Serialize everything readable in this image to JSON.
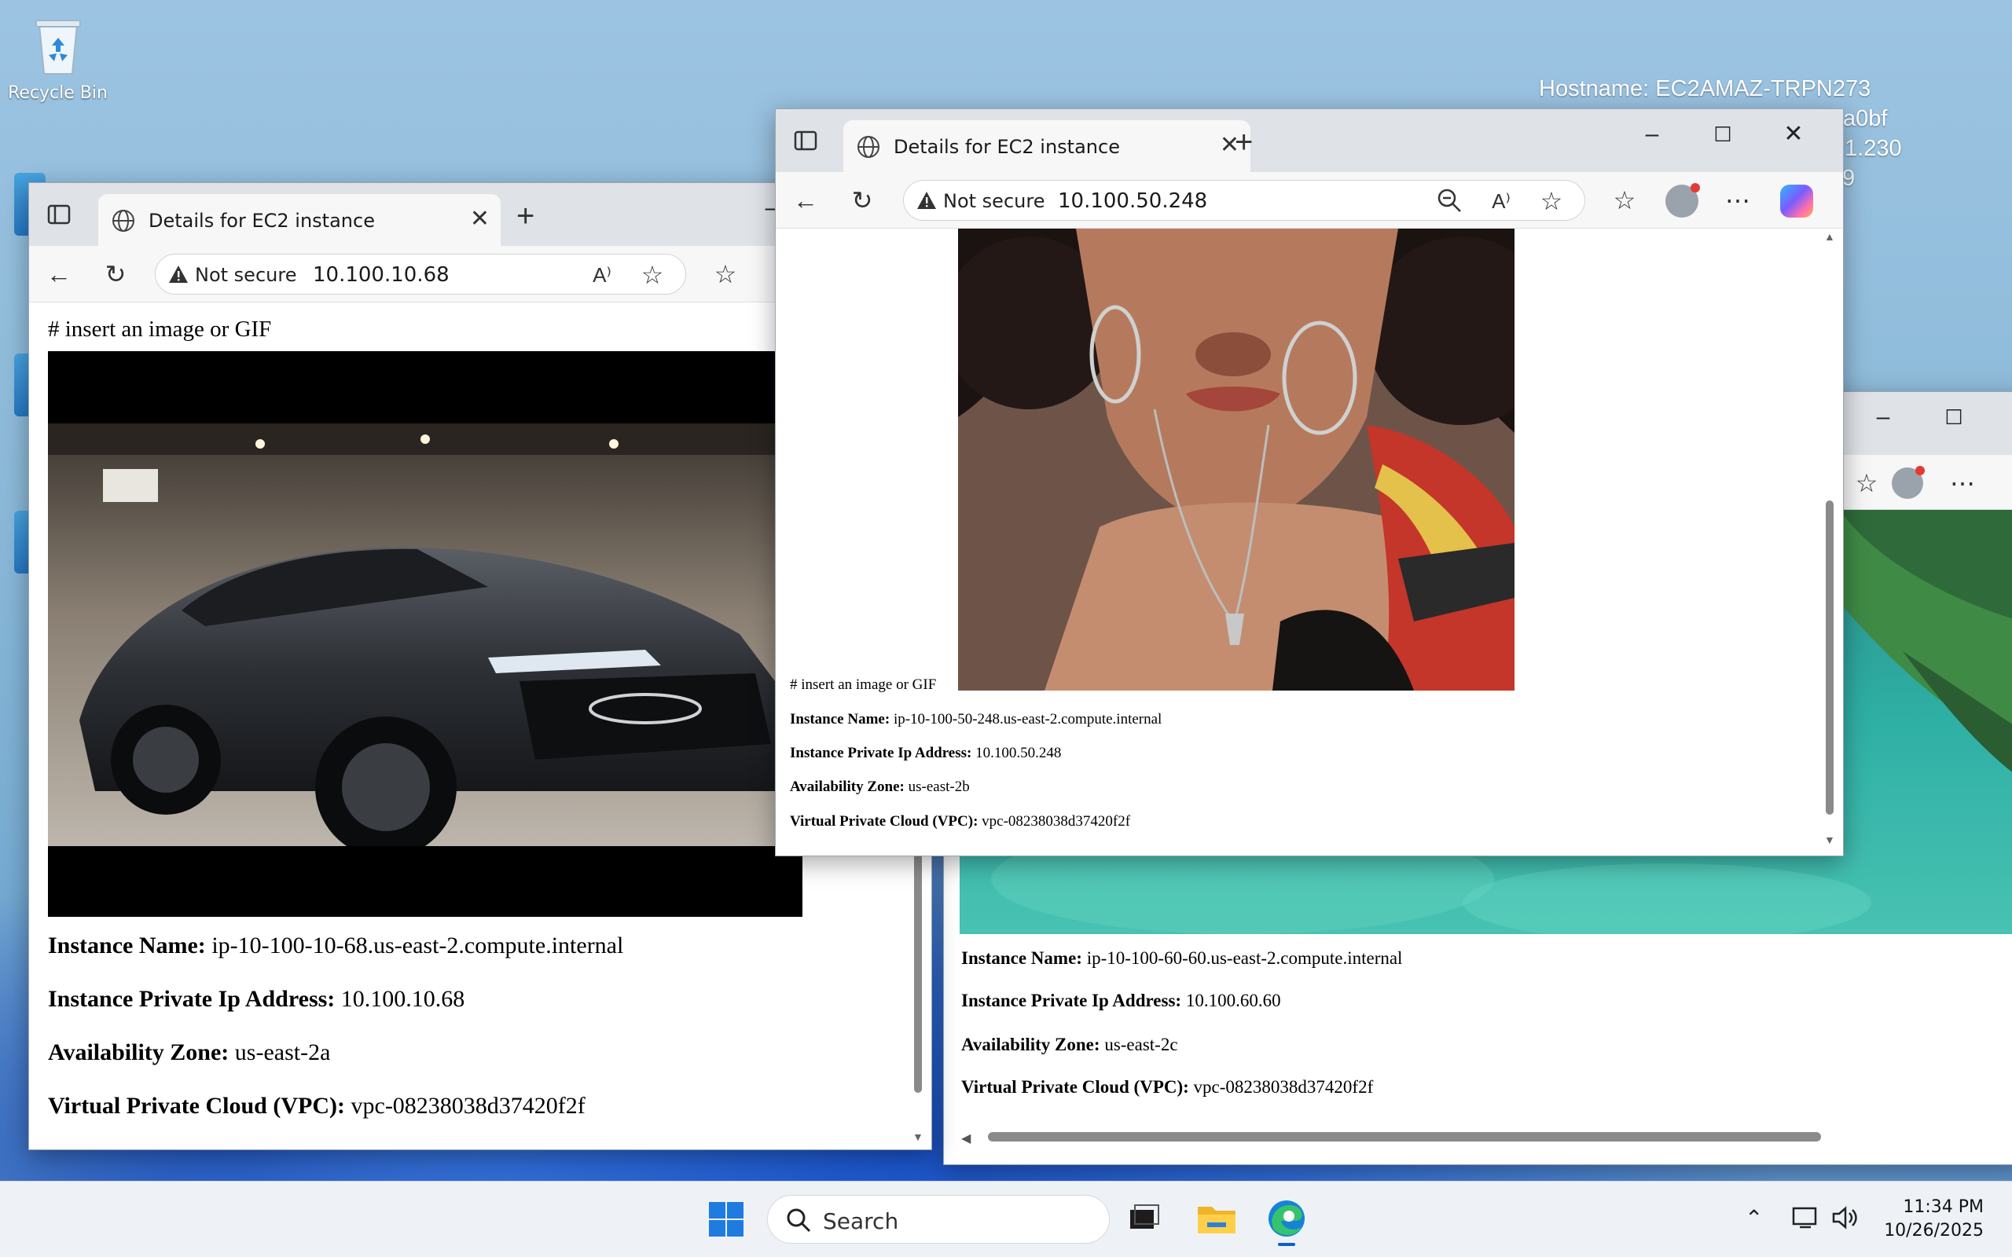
{
  "desktop": {
    "recycle_bin_label": "Recycle Bin",
    "bginfo": {
      "hostname": "Hostname: EC2AMAZ-TRPN273",
      "line2_fragment": "a0bf",
      "line3_fragment": ".1.230",
      "line4_fragment": "9"
    }
  },
  "window_left": {
    "tab_title": "Details for EC2 instance",
    "not_secure": "Not secure",
    "url": "10.100.10.68",
    "heading": "# insert an image or GIF",
    "image_alt": "Dark grey Audi sedan parked in a showroom garage",
    "instance_name_label": "Instance Name:",
    "instance_name_value": "ip-10-100-10-68.us-east-2.compute.internal",
    "ip_label": "Instance Private Ip Address:",
    "ip_value": "10.100.10.68",
    "az_label": "Availability Zone:",
    "az_value": "us-east-2a",
    "vpc_label": "Virtual Private Cloud (VPC):",
    "vpc_value": "vpc-08238038d37420f2f"
  },
  "window_right": {
    "instance_name_label": "Instance Name:",
    "instance_name_value": "ip-10-100-60-60.us-east-2.compute.internal",
    "ip_label": "Instance Private Ip Address:",
    "ip_value": "10.100.60.60",
    "az_label": "Availability Zone:",
    "az_value": "us-east-2c",
    "vpc_label": "Virtual Private Cloud (VPC):",
    "vpc_value": "vpc-08238038d37420f2f",
    "image_alt": "Aerial view of turquoise sea and green coastline"
  },
  "window_front": {
    "tab_title": "Details for EC2 instance",
    "not_secure": "Not secure",
    "url": "10.100.50.248",
    "image_alt": "Woman with curly hair wearing hoop earrings and a pendant necklace",
    "heading": "# insert an image or GIF",
    "instance_name_label": "Instance Name:",
    "instance_name_value": "ip-10-100-50-248.us-east-2.compute.internal",
    "ip_label": "Instance Private Ip Address:",
    "ip_value": "10.100.50.248",
    "az_label": "Availability Zone:",
    "az_value": "us-east-2b",
    "vpc_label": "Virtual Private Cloud (VPC):",
    "vpc_value": "vpc-08238038d37420f2f"
  },
  "taskbar": {
    "search_label": "Search",
    "time": "11:34 PM",
    "date": "10/26/2025"
  },
  "colors": {
    "accent": "#0a5fd0",
    "tabbar": "#dfe3e8",
    "warning_icon": "#333333"
  }
}
